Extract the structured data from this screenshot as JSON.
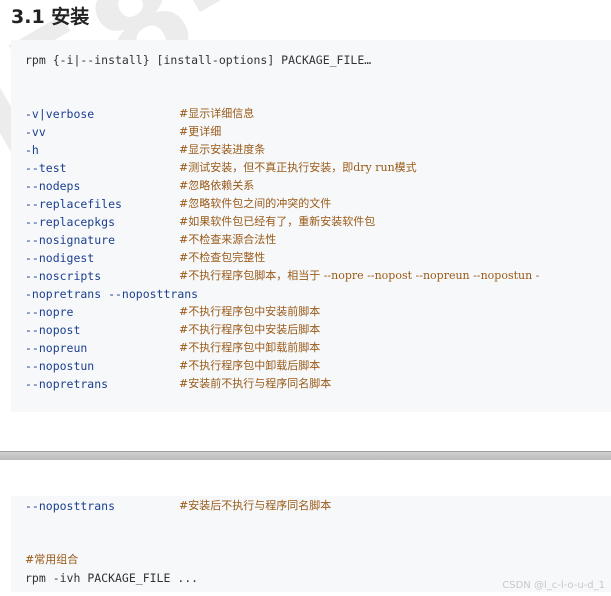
{
  "heading": "3.1 安装",
  "watermark": "l58-",
  "box1": {
    "usage": "rpm {-i|--install} [install-options] PACKAGE_FILE…",
    "options": [
      {
        "opt": "-v|verbose",
        "comment": "#显示详细信息"
      },
      {
        "opt": "-vv",
        "comment": "#更详细"
      },
      {
        "opt": "-h",
        "comment": "#显示安装进度条"
      },
      {
        "opt": "--test",
        "comment": "#测试安装，但不真正执行安装，即dry run模式"
      },
      {
        "opt": "--nodeps",
        "comment": "#忽略依赖关系"
      },
      {
        "opt": "--replacefiles",
        "comment": "#忽略软件包之间的冲突的文件"
      },
      {
        "opt": "--replacepkgs",
        "comment": "#如果软件包已经有了，重新安装软件包"
      },
      {
        "opt": "--nosignature",
        "comment": "#不检查来源合法性"
      },
      {
        "opt": "--nodigest",
        "comment": "#不检查包完整性"
      },
      {
        "opt": "--noscripts",
        "comment": "#不执行程序包脚本，相当于 --nopre --nopost --nopreun --nopostun -"
      },
      {
        "opt": "-nopretrans --noposttrans",
        "comment": ""
      },
      {
        "opt": "--nopre",
        "comment": "#不执行程序包中安装前脚本"
      },
      {
        "opt": "--nopost",
        "comment": "#不执行程序包中安装后脚本"
      },
      {
        "opt": "--nopreun",
        "comment": "#不执行程序包中卸载前脚本"
      },
      {
        "opt": "--nopostun",
        "comment": "#不执行程序包中卸载后脚本"
      },
      {
        "opt": "--nopretrans",
        "comment": "#安装前不执行与程序同名脚本"
      }
    ]
  },
  "box2": {
    "options": [
      {
        "opt": "--noposttrans",
        "comment": "#安装后不执行与程序同名脚本"
      }
    ],
    "section_comment": "#常用组合",
    "example_cmd": "rpm -ivh",
    "example_args": " PACKAGE_FILE ..."
  },
  "credit": "CSDN @l_c-l-o-u-d_1"
}
